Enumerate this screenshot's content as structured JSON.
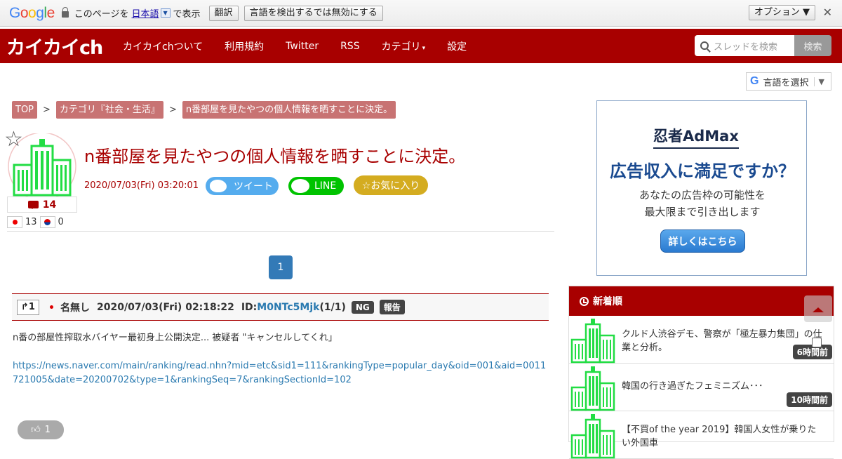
{
  "google_bar": {
    "logo": "Google",
    "prefix": "このページを",
    "language": "日本語",
    "dropdown": "▼",
    "suffix": "で表示",
    "translate_button": "翻訳",
    "disable_button": "言語を検出するでは無効にする",
    "options_button": "オプション ▼",
    "close": "✕"
  },
  "header": {
    "logo": "カイカイch",
    "nav": [
      "カイカイchついて",
      "利用規約",
      "Twitter",
      "RSS",
      "カテゴリ",
      "設定"
    ],
    "nav_caret": "▾",
    "search_placeholder": "スレッドを検索",
    "search_button": "検索"
  },
  "lang_selector": {
    "logo": "G",
    "label": "言語を選択",
    "arrow": "▼"
  },
  "breadcrumb": [
    "TOP",
    "カテゴリ『社会・生活』",
    "n番部屋を見たやつの個人情報を晒すことに決定。"
  ],
  "breadcrumb_sep": ">",
  "thread": {
    "title": "n番部屋を見たやつの個人情報を晒すことに決定。",
    "date": "2020/07/03(Fri) 03:20:01",
    "comment_count": "14",
    "jp_count": "13",
    "kr_count": "0",
    "favorite_star": "☆",
    "tweet_label": "ツイート",
    "line_label": "LINE",
    "fav_label": "☆お気に入り"
  },
  "pager": {
    "current": "1"
  },
  "post": {
    "res_label": "1",
    "name": "名無し",
    "date": "2020/07/03(Fri) 02:18:22",
    "id_prefix": "ID:",
    "id_value": "M0NTc5Mjk",
    "id_suffix": "(1/1)",
    "ng": "NG",
    "report": "報告",
    "body": "n番の部屋性搾取水バイヤー最初身上公開決定... 被疑者 \"キャンセルしてくれ」",
    "link": "https://news.naver.com/main/ranking/read.nhn?mid=etc&sid1=111&rankingType=popular_day&oid=001&aid=0011721005&date=20200702&type=1&rankingSeq=7&rankingSectionId=102",
    "likes": "1"
  },
  "ad": {
    "brand": "忍者AdMax",
    "headline": "広告収入に満足ですか？",
    "sub1": "あなたの広告枠の可能性を",
    "sub2": "最大限まで引き出します",
    "button": "詳しくはこちら"
  },
  "sidebar": {
    "heading": "新着順",
    "items": [
      {
        "title": "クルド人渋谷デモ、警察が「極左暴力集団」の仕業と分析。",
        "time": "6時間前"
      },
      {
        "title": "韓国の行き過ぎたフェミニズム･･･",
        "time": "10時間前"
      },
      {
        "title": "【不買of the year 2019】韓国人女性が乗りたい外国車",
        "time": ""
      }
    ]
  },
  "colors": {
    "brand": "#a80000",
    "crumb": "#c87373",
    "twitter": "#55acee",
    "line": "#00c300",
    "fav": "#d4ac20",
    "pager": "#337ab7"
  }
}
